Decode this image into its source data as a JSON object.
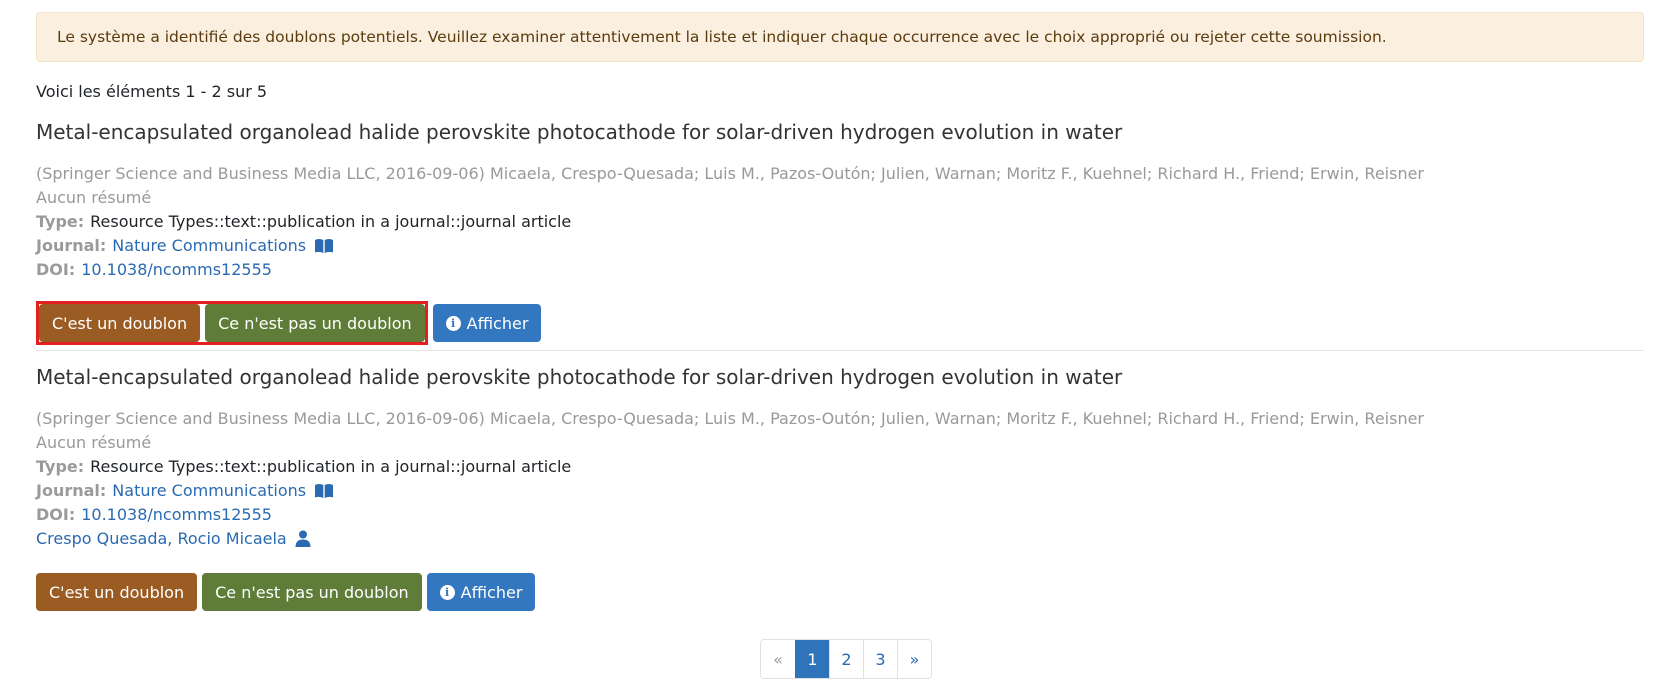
{
  "alert": {
    "text": "Le système a identifié des doublons potentiels. Veuillez examiner attentivement la liste et indiquer chaque occurrence avec le choix approprié ou rejeter cette soumission."
  },
  "summary": "Voici les éléments 1 - 2 sur 5",
  "items": [
    {
      "title": "Metal-encapsulated organolead halide perovskite photocathode for solar-driven hydrogen evolution in water",
      "meta": "(Springer Science and Business Media LLC, 2016-09-06) Micaela, Crespo-Quesada; Luis M., Pazos-Outón; Julien, Warnan; Moritz F., Kuehnel; Richard H., Friend; Erwin, Reisner",
      "abstract": "Aucun résumé",
      "type_label": "Type:",
      "type_value": "Resource Types::text::publication in a journal::journal article",
      "journal_label": "Journal:",
      "journal_value": "Nature Communications",
      "doi_label": "DOI:",
      "doi_value": "10.1038/ncomms12555"
    },
    {
      "title": "Metal-encapsulated organolead halide perovskite photocathode for solar-driven hydrogen evolution in water",
      "meta": "(Springer Science and Business Media LLC, 2016-09-06) Micaela, Crespo-Quesada; Luis M., Pazos-Outón; Julien, Warnan; Moritz F., Kuehnel; Richard H., Friend; Erwin, Reisner",
      "abstract": "Aucun résumé",
      "type_label": "Type:",
      "type_value": "Resource Types::text::publication in a journal::journal article",
      "journal_label": "Journal:",
      "journal_value": "Nature Communications",
      "doi_label": "DOI:",
      "doi_value": "10.1038/ncomms12555",
      "person": "Crespo Quesada, Rocio Micaela"
    }
  ],
  "buttons": {
    "duplicate": "C'est un doublon",
    "not_duplicate": "Ce n'est pas un doublon",
    "view": "Afficher"
  },
  "pagination": {
    "prev": "«",
    "pages": [
      "1",
      "2",
      "3"
    ],
    "next": "»",
    "active": "1"
  },
  "colors": {
    "duplicate_button": "#9b5c24",
    "not_duplicate_button": "#5f7d38",
    "view_button": "#3277bf",
    "highlight_border": "#e31f1f",
    "alert_background": "#fbefdf"
  }
}
